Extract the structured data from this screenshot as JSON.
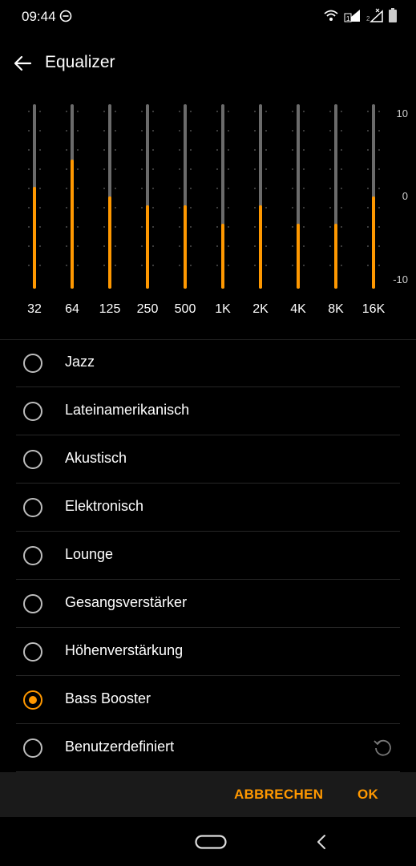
{
  "status": {
    "time": "09:44"
  },
  "header": {
    "title": "Equalizer"
  },
  "equalizer": {
    "bands": [
      {
        "label": "32",
        "level": 0.55
      },
      {
        "label": "64",
        "level": 0.7
      },
      {
        "label": "125",
        "level": 0.5
      },
      {
        "label": "250",
        "level": 0.45
      },
      {
        "label": "500",
        "level": 0.45
      },
      {
        "label": "1K",
        "level": 0.35
      },
      {
        "label": "2K",
        "level": 0.45
      },
      {
        "label": "4K",
        "level": 0.35
      },
      {
        "label": "8K",
        "level": 0.35
      },
      {
        "label": "16K",
        "level": 0.5
      }
    ],
    "scale": {
      "top": "10",
      "mid": "0",
      "bottom": "-10"
    }
  },
  "presets": [
    {
      "label": "Jazz",
      "selected": false
    },
    {
      "label": "Lateinamerikanisch",
      "selected": false
    },
    {
      "label": "Akustisch",
      "selected": false
    },
    {
      "label": "Elektronisch",
      "selected": false
    },
    {
      "label": "Lounge",
      "selected": false
    },
    {
      "label": "Gesangsverstärker",
      "selected": false
    },
    {
      "label": "Höhenverstärkung",
      "selected": false
    },
    {
      "label": "Bass Booster",
      "selected": true
    },
    {
      "label": "Benutzerdefiniert",
      "selected": false
    }
  ],
  "actions": {
    "cancel": "ABBRECHEN",
    "ok": "OK"
  },
  "colors": {
    "accent": "#ff9800",
    "track": "#6b6b6b",
    "background": "#000000"
  },
  "icons": [
    "back-arrow-icon",
    "dnd-icon",
    "wifi-icon",
    "signal-icon",
    "battery-icon",
    "reset-icon",
    "home-pill-icon",
    "nav-back-icon"
  ]
}
